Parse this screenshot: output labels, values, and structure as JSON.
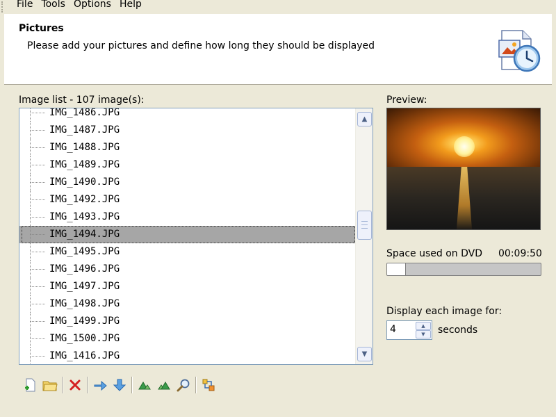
{
  "menu": {
    "items": [
      "File",
      "Tools",
      "Options",
      "Help"
    ]
  },
  "header": {
    "title": "Pictures",
    "subtitle": "Please add your pictures and define how long they should be displayed",
    "icon": "pictures-clock-icon"
  },
  "image_list": {
    "label": "Image list - 107 image(s):",
    "items": [
      "IMG_1486.JPG",
      "IMG_1487.JPG",
      "IMG_1488.JPG",
      "IMG_1489.JPG",
      "IMG_1490.JPG",
      "IMG_1492.JPG",
      "IMG_1493.JPG",
      "IMG_1494.JPG",
      "IMG_1495.JPG",
      "IMG_1496.JPG",
      "IMG_1497.JPG",
      "IMG_1498.JPG",
      "IMG_1499.JPG",
      "IMG_1500.JPG",
      "IMG_1416.JPG"
    ],
    "selected": "IMG_1494.JPG"
  },
  "preview": {
    "label": "Preview:"
  },
  "dvd": {
    "label": "Space used on DVD",
    "time": "00:09:50",
    "used_fraction": 0.12
  },
  "display": {
    "label": "Display each image for:",
    "value": "4",
    "unit": "seconds"
  },
  "toolbar": {
    "icons": [
      "add-file-icon",
      "add-folder-icon",
      "delete-icon",
      "move-up-icon",
      "move-down-icon",
      "rotate-left-icon",
      "rotate-right-icon",
      "zoom-icon",
      "properties-icon"
    ]
  }
}
